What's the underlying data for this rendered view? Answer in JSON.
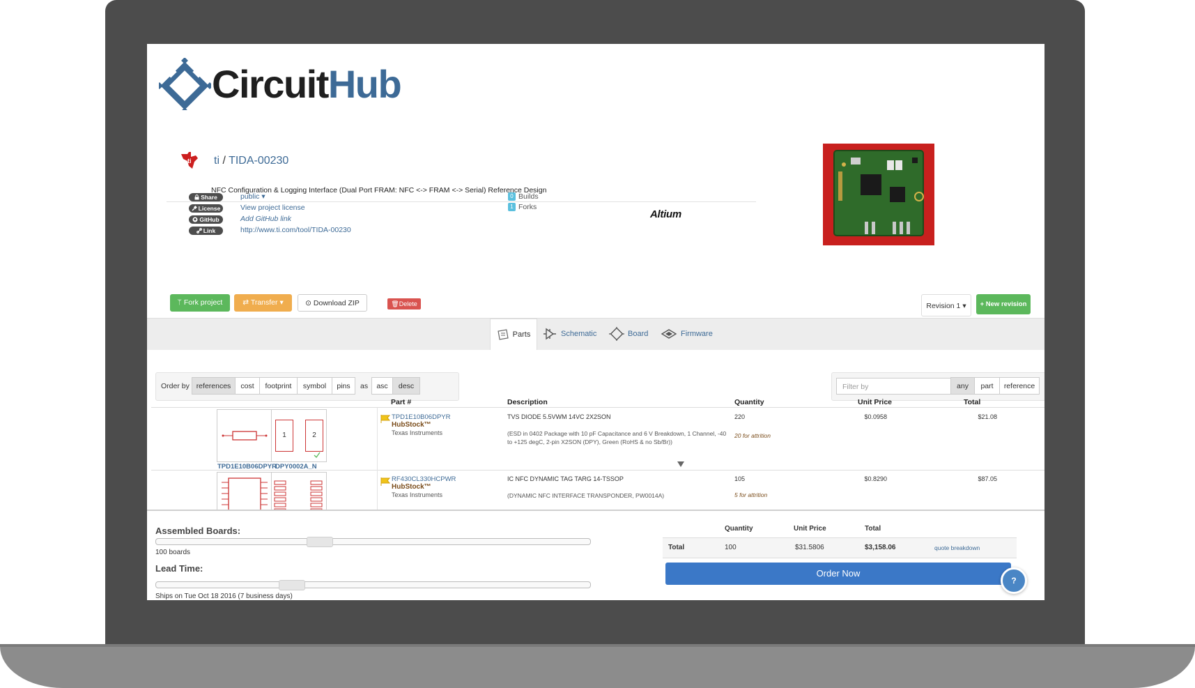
{
  "brand": {
    "name_part1": "Circuit",
    "name_part2": "Hub"
  },
  "project": {
    "owner": "ti",
    "separator": "/",
    "name": "TIDA-00230",
    "description": "NFC Configuration & Logging Interface (Dual Port FRAM: NFC <-> FRAM <-> Serial) Reference Design"
  },
  "meta": {
    "share_label": "Share",
    "share_value": "public",
    "license_label": "License",
    "license_value": "View project license",
    "github_label": "GitHub",
    "github_value": "Add GitHub link",
    "link_label": "Link",
    "link_value": "http://www.ti.com/tool/TIDA-00230"
  },
  "stats": {
    "builds_count": "0",
    "builds_label": "Builds",
    "forks_count": "1",
    "forks_label": "Forks"
  },
  "tool_badge": "Altium",
  "actions": {
    "fork": "Fork project",
    "transfer": "Transfer",
    "download": "Download ZIP",
    "delete": "Delete",
    "revision": "Revision 1",
    "new_revision": "New revision"
  },
  "tabs": {
    "parts": "Parts",
    "schematic": "Schematic",
    "board": "Board",
    "firmware": "Firmware"
  },
  "order_by": {
    "label": "Order by",
    "options": [
      "references",
      "cost",
      "footprint",
      "symbol",
      "pins"
    ],
    "as_label": "as",
    "directions": [
      "asc",
      "desc"
    ]
  },
  "filter": {
    "placeholder": "Filter by",
    "options": [
      "any",
      "part",
      "reference"
    ]
  },
  "table": {
    "headers": {
      "part": "Part #",
      "description": "Description",
      "quantity": "Quantity",
      "unit_price": "Unit Price",
      "total": "Total"
    },
    "rows": [
      {
        "symbol_label": "TPD1E10B06DPYR",
        "footprint_label": "DPY0002A_N",
        "pad1": "1",
        "pad2": "2",
        "part_number": "TPD1E10B06DPYR",
        "stock": "HubStock™",
        "manufacturer": "Texas Instruments",
        "description": "TVS DIODE 5.5VWM 14VC 2X2SON",
        "details_line1": "(ESD in 0402 Package with 10 pF Capacitance and 6 V Breakdown, 1 Channel, -40",
        "details_line2": "to +125 degC, 2-pin X2SON (DPY), Green (RoHS & no Sb/Br))",
        "quantity": "220",
        "attrition": "20 for attrition",
        "unit_price": "$0.0958",
        "total": "$21.08"
      },
      {
        "part_number": "RF430CL330HCPWR",
        "stock": "HubStock™",
        "manufacturer": "Texas Instruments",
        "description": "IC NFC DYNAMIC TAG TARG 14-TSSOP",
        "details_line1": "(DYNAMIC NFC INTERFACE TRANSPONDER, PW0014A)",
        "quantity": "105",
        "attrition": "5 for attrition",
        "unit_price": "$0.8290",
        "total": "$87.05"
      }
    ]
  },
  "order": {
    "boards_label": "Assembled Boards:",
    "boards_value": "100 boards",
    "lead_label": "Lead Time:",
    "lead_value": "Ships on Tue Oct 18 2016 (7 business days)",
    "headers": {
      "quantity": "Quantity",
      "unit_price": "Unit Price",
      "total": "Total"
    },
    "total_label": "Total",
    "quantity": "100",
    "unit_price": "$31.5806",
    "total": "$3,158.06",
    "breakdown_link": "quote breakdown",
    "order_button": "Order Now",
    "help_icon": "?"
  },
  "colors": {
    "link": "#3d6a96",
    "success": "#5cb85c",
    "warning": "#f0ad4e",
    "danger": "#d9534f",
    "primary": "#3b78c7"
  }
}
